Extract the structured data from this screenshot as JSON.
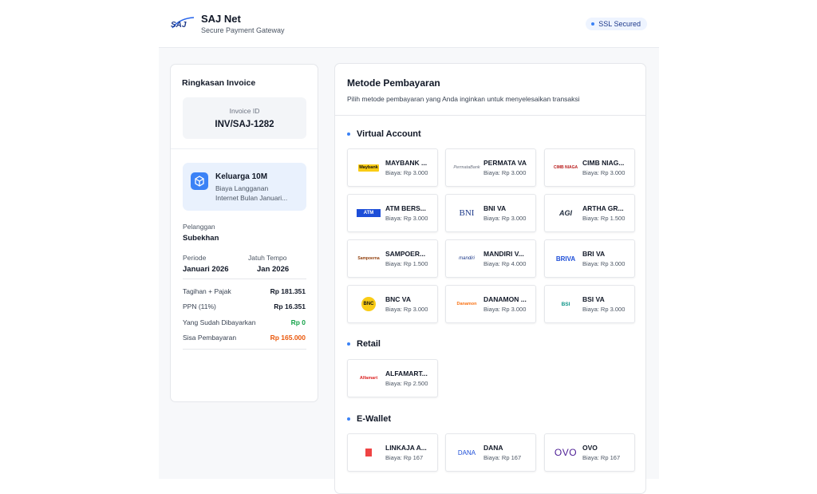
{
  "header": {
    "logo_text": "SAJ",
    "title": "SAJ Net",
    "subtitle": "Secure Payment Gateway",
    "ssl_label": "SSL Secured"
  },
  "invoice": {
    "title": "Ringkasan Invoice",
    "id_label": "Invoice ID",
    "id_value": "INV/SAJ-1282",
    "product_name": "Keluarga 10M",
    "product_desc_1": "Biaya Langganan",
    "product_desc_2": "Internet Bulan Januari...",
    "customer_label": "Pelanggan",
    "customer_value": "Subekhan",
    "period_label": "Periode",
    "period_value": "Januari 2026",
    "due_label": "Jatuh Tempo",
    "due_value": "Jan 2026",
    "rows": [
      {
        "label": "Tagihan + Pajak",
        "value": "Rp 181.351"
      },
      {
        "label": "PPN (11%)",
        "value": "Rp 16.351"
      },
      {
        "label": "Yang Sudah Dibayarkan",
        "value": "Rp 0"
      },
      {
        "label": "Sisa Pembayaran",
        "value": "Rp 165.000"
      }
    ],
    "colors": {
      "paid": "#16a34a",
      "remaining": "#ea580c"
    }
  },
  "methods": {
    "title": "Metode Pembayaran",
    "subtitle": "Pilih metode pembayaran yang Anda inginkan untuk menyelesaikan transaksi",
    "sections": [
      {
        "name": "Virtual Account",
        "items": [
          {
            "name": "MAYBANK ...",
            "fee": "Biaya: Rp 3.000",
            "logo": "Maybank"
          },
          {
            "name": "PERMATA VA",
            "fee": "Biaya: Rp 3.000",
            "logo": "PermataBank"
          },
          {
            "name": "CIMB NIAG...",
            "fee": "Biaya: Rp 3.000",
            "logo": "CIMB NIAGA"
          },
          {
            "name": "ATM BERS...",
            "fee": "Biaya: Rp 3.000",
            "logo": "ATM"
          },
          {
            "name": "BNI VA",
            "fee": "Biaya: Rp 3.000",
            "logo": "BNI"
          },
          {
            "name": "ARTHA GR...",
            "fee": "Biaya: Rp 1.500",
            "logo": "AGI"
          },
          {
            "name": "SAMPOER...",
            "fee": "Biaya: Rp 1.500",
            "logo": "Sampoerna"
          },
          {
            "name": "MANDIRI V...",
            "fee": "Biaya: Rp 4.000",
            "logo": "mandiri"
          },
          {
            "name": "BRI VA",
            "fee": "Biaya: Rp 3.000",
            "logo": "BRIVA"
          },
          {
            "name": "BNC VA",
            "fee": "Biaya: Rp 3.000",
            "logo": "BNC"
          },
          {
            "name": "DANAMON ...",
            "fee": "Biaya: Rp 3.000",
            "logo": "Danamon"
          },
          {
            "name": "BSI VA",
            "fee": "Biaya: Rp 3.000",
            "logo": "BSI"
          }
        ]
      },
      {
        "name": "Retail",
        "items": [
          {
            "name": "ALFAMART...",
            "fee": "Biaya: Rp 2.500",
            "logo": "Alfamart"
          }
        ]
      },
      {
        "name": "E-Wallet",
        "items": [
          {
            "name": "LINKAJA A...",
            "fee": "Biaya: Rp 167",
            "logo": "LinkAja"
          },
          {
            "name": "DANA",
            "fee": "Biaya: Rp 167",
            "logo": "DANA"
          },
          {
            "name": "OVO",
            "fee": "Biaya: Rp 167",
            "logo": "OVO"
          }
        ]
      }
    ]
  }
}
